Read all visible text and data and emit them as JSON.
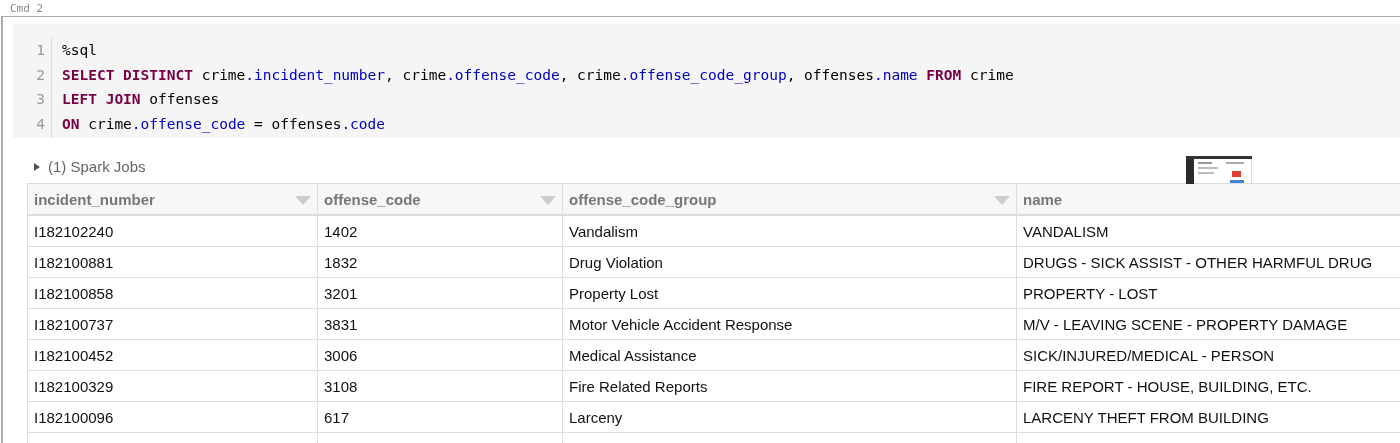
{
  "cell": {
    "label": "Cmd 2",
    "code": [
      {
        "number": "1",
        "tokens": [
          {
            "text": "%sql",
            "kind": "plain"
          }
        ]
      },
      {
        "number": "2",
        "tokens": [
          {
            "text": "SELECT DISTINCT",
            "kind": "keyword"
          },
          {
            "text": " crime",
            "kind": "plain"
          },
          {
            "text": ".incident_number",
            "kind": "field"
          },
          {
            "text": ", crime",
            "kind": "plain"
          },
          {
            "text": ".offense_code",
            "kind": "field"
          },
          {
            "text": ", crime",
            "kind": "plain"
          },
          {
            "text": ".offense_code_group",
            "kind": "field"
          },
          {
            "text": ", offenses",
            "kind": "plain"
          },
          {
            "text": ".name",
            "kind": "field"
          },
          {
            "text": " FROM",
            "kind": "keyword"
          },
          {
            "text": " crime",
            "kind": "plain"
          }
        ]
      },
      {
        "number": "3",
        "tokens": [
          {
            "text": "LEFT JOIN",
            "kind": "keyword"
          },
          {
            "text": " offenses",
            "kind": "plain"
          }
        ]
      },
      {
        "number": "4",
        "tokens": [
          {
            "text": "ON",
            "kind": "keyword"
          },
          {
            "text": " crime",
            "kind": "plain"
          },
          {
            "text": ".offense_code",
            "kind": "field"
          },
          {
            "text": " = offenses",
            "kind": "plain"
          },
          {
            "text": ".code",
            "kind": "field"
          }
        ]
      }
    ],
    "spark_jobs": {
      "label": "(1) Spark Jobs",
      "expanded": false
    },
    "table": {
      "columns": [
        {
          "name": "incident_number",
          "sort_menu": true
        },
        {
          "name": "offense_code",
          "sort_menu": true
        },
        {
          "name": "offense_code_group",
          "sort_menu": true
        },
        {
          "name": "name",
          "sort_menu": false
        }
      ],
      "rows": [
        [
          "I182102240",
          "1402",
          "Vandalism",
          "VANDALISM"
        ],
        [
          "I182100881",
          "1832",
          "Drug Violation",
          "DRUGS - SICK ASSIST - OTHER HARMFUL DRUG"
        ],
        [
          "I182100858",
          "3201",
          "Property Lost",
          "PROPERTY - LOST"
        ],
        [
          "I182100737",
          "3831",
          "Motor Vehicle Accident Response",
          "M/V - LEAVING SCENE - PROPERTY DAMAGE"
        ],
        [
          "I182100452",
          "3006",
          "Medical Assistance",
          "SICK/INJURED/MEDICAL - PERSON"
        ],
        [
          "I182100329",
          "3108",
          "Fire Related Reports",
          "FIRE REPORT - HOUSE, BUILDING, ETC."
        ],
        [
          "I182100096",
          "617",
          "Larceny",
          "LARCENY THEFT FROM BUILDING"
        ]
      ]
    }
  }
}
